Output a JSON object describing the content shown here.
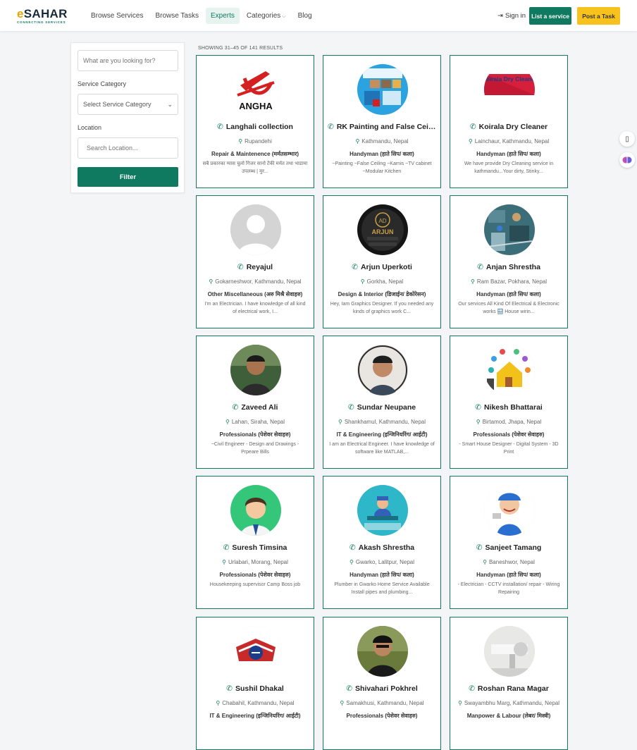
{
  "brand": {
    "logo_main": "eSAHAR",
    "logo_e": "e",
    "logo_rest": "SAHAR",
    "logo_sub": "CONNECTING SERVICES",
    "accent": "#0f7a5f",
    "yellow": "#f7c21c"
  },
  "nav": {
    "items": [
      {
        "label": "Browse Services"
      },
      {
        "label": "Browse Tasks"
      },
      {
        "label": "Experts"
      },
      {
        "label": "Categories"
      },
      {
        "label": "Blog"
      }
    ],
    "signin": "Sign in",
    "list_service": "List a service",
    "post_task": "Post a Task"
  },
  "sidebar": {
    "search_placeholder": "What are you looking for?",
    "category_label": "Service Category",
    "category_value": "Select Service Category",
    "location_label": "Location",
    "location_placeholder": "Search Location...",
    "filter_label": "Filter"
  },
  "results": {
    "showing": "SHOWING 31–45 OF 141 RESULTS"
  },
  "cards": [
    {
      "name": "Langhali collection",
      "location": "Rupandehi",
      "category": "Repair & Maintenence (मर्मतसम्भार)",
      "desc": "सबै प्रकारका ग्यास चुलो गिजर सानो टेंकी मर्मत तथा भाडामा उपलब्ध | मुर...",
      "avatar": "langhali"
    },
    {
      "name": "RK Painting and False Ceiling",
      "location": "Kathmandu, Nepal",
      "category": "Handyman (हाते सिप/ कला)",
      "desc": "~Painting ~False Ceiling ~Karnis ~TV cabinet ~Modular Kitchen",
      "avatar": "poster"
    },
    {
      "name": "Koirala Dry Cleaner",
      "location": "Lainchaur, Kathmandu, Nepal",
      "category": "Handyman (हाते सिप/ कला)",
      "desc": "We have provide Dry Cleaning service in kathmandu...Your dirty, Stinky...",
      "avatar": "flag"
    },
    {
      "name": "Reyajul",
      "location": "Gokarneshwor, Kathmandu, Nepal",
      "category": "Other Miscellaneous (अरु मिश्रै सेवाहरु)",
      "desc": "I'm an Electrician. I have knowledge of all kind of electrical work, I...",
      "avatar": "default"
    },
    {
      "name": "Arjun Uperkoti",
      "location": "Gorkha, Nepal",
      "category": "Design & Interior (डिजाईन/ डेकोरेसन)",
      "desc": "Hey, Iam Graphics Designer. If you needed any kinds of graphics work C...",
      "avatar": "arjun"
    },
    {
      "name": "Anjan Shrestha",
      "location": "Ram Bazar, Pokhara, Nepal",
      "category": "Handyman (हाते सिप/ कला)",
      "desc": "Our services All Kind Of Electrical & Electronic works 🔜 House wirin...",
      "avatar": "circuit"
    },
    {
      "name": "Zaveed Ali",
      "location": "Lahan, Siraha, Nepal",
      "category": "Professionals (पेशेवर सेवाहरु)",
      "desc": "~Civil Engineer - Design and Drawings - Prpeare Bills",
      "avatar": "person1"
    },
    {
      "name": "Sundar Neupane",
      "location": "Shankhamul, Kathmandu, Nepal",
      "category": "IT & Engineering (इन्जिनियरिंग/ आईटी)",
      "desc": "I am an Electrical Engineer. I have knowledge of software like MATLAB,...",
      "avatar": "person2"
    },
    {
      "name": "Nikesh Bhattarai",
      "location": "Birtamod, Jhapa, Nepal",
      "category": "Professionals (पेशेवर सेवाहरु)",
      "desc": "- Smart House Designer - Digital System - 3D Print",
      "avatar": "smarthouse"
    },
    {
      "name": "Suresh Timsina",
      "location": "Urlabari, Morang, Nepal",
      "category": "Professionals (पेशेवर सेवाहरु)",
      "desc": "Housekeeping supervisor Camp Boss job",
      "avatar": "cartoon"
    },
    {
      "name": "Akash Shrestha",
      "location": "Gwarko, Lalitpur, Nepal",
      "category": "Handyman (हाते सिप/ कला)",
      "desc": "Plumber in Gwarko Home Service Available Install pipes and plumbing...",
      "avatar": "plumber"
    },
    {
      "name": "Sanjeet Tamang",
      "location": "Baneshwor, Nepal",
      "category": "Handyman (हाते सिप/ कला)",
      "desc": "- Electrician - CCTV installation/ repair - Wiring Repairing",
      "avatar": "mascot"
    },
    {
      "name": "Sushil Dhakal",
      "location": "Chabahil, Kathmandu, Nepal",
      "category": "IT & Engineering (इन्जिनियरिंग/ आईटी)",
      "desc": "",
      "avatar": "badge"
    },
    {
      "name": "Shivahari Pokhrel",
      "location": "Samakhusi, Kathmandu, Nepal",
      "category": "Professionals (पेशेवर सेवाहरु)",
      "desc": "",
      "avatar": "person3"
    },
    {
      "name": "Roshan Rana Magar",
      "location": "Swayambhu Marg, Kathmandu, Nepal",
      "category": "Manpower & Labour (लेबर/ मिस्त्री)",
      "desc": "",
      "avatar": "pipe"
    }
  ]
}
